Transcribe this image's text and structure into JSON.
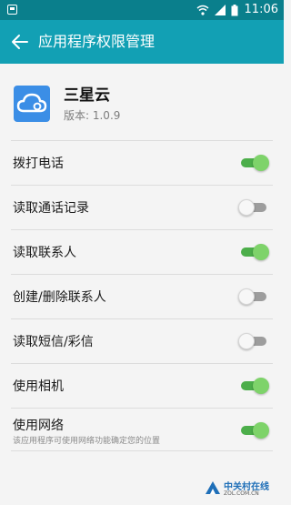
{
  "status_bar": {
    "time": "11:06",
    "icons": [
      "wifi-icon",
      "signal-icon",
      "battery-icon"
    ]
  },
  "app_bar": {
    "title": "应用程序权限管理",
    "back_icon": "arrow-left-icon"
  },
  "app": {
    "name": "三星云",
    "version": "版本: 1.0.9",
    "icon": "cloud-icon"
  },
  "permissions": [
    {
      "label": "拨打电话",
      "enabled": true
    },
    {
      "label": "读取通话记录",
      "enabled": false
    },
    {
      "label": "读取联系人",
      "enabled": true
    },
    {
      "label": "创建/删除联系人",
      "enabled": false
    },
    {
      "label": "读取短信/彩信",
      "enabled": false
    },
    {
      "label": "使用相机",
      "enabled": true
    },
    {
      "label": "使用网络",
      "subtitle": "该应用程序可使用网络功能确定您的位置",
      "enabled": true
    }
  ],
  "watermark": {
    "title": "中关村在线",
    "domain": "ZOL.COM.CN"
  },
  "colors": {
    "status_bar": "#0a7f8c",
    "app_bar": "#12a0b4",
    "toggle_on": "#7ed36a",
    "toggle_off": "#9d9d9d"
  }
}
